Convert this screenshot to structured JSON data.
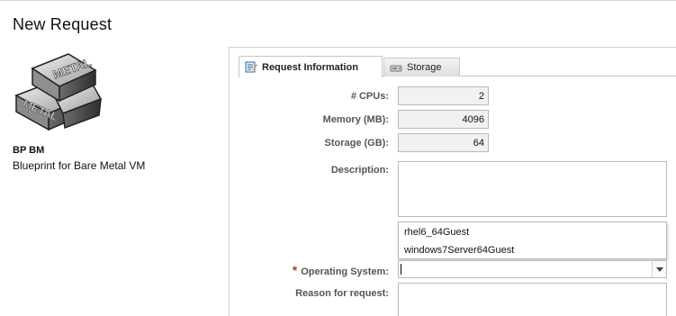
{
  "page": {
    "title": "New Request"
  },
  "blueprint": {
    "logo_text": "METAL",
    "name": "BP BM",
    "description": "Blueprint for  Bare Metal VM"
  },
  "tabs": [
    {
      "label": "Request Information",
      "icon": "form-icon",
      "active": true
    },
    {
      "label": "Storage",
      "icon": "disk-icon",
      "active": false
    }
  ],
  "form": {
    "cpus": {
      "label": "# CPUs:",
      "value": "2"
    },
    "memory": {
      "label": "Memory (MB):",
      "value": "4096"
    },
    "storage": {
      "label": "Storage (GB):",
      "value": "64"
    },
    "description": {
      "label": "Description:",
      "value": ""
    },
    "os": {
      "label": "Operating System:",
      "required_mark": "*",
      "value": "",
      "options": [
        "rhel6_64Guest",
        "windows7Server64Guest"
      ]
    },
    "reason": {
      "label": "Reason for request:",
      "value": ""
    }
  },
  "colors": {
    "required": "#c0392b",
    "field_bg": "#f1f1f1",
    "border": "#b9b9b9"
  }
}
